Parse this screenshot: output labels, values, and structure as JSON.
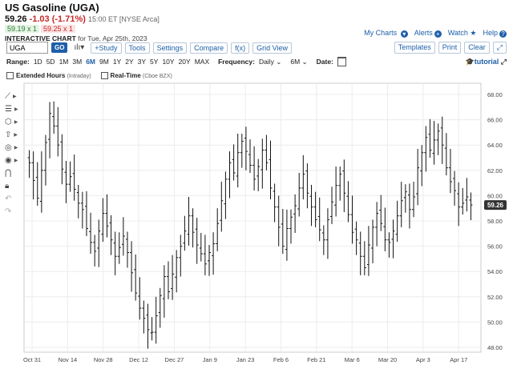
{
  "header": {
    "title": "US Gasoline (UGA)",
    "last": "59.26",
    "change": "-1.03 (-1.71%)",
    "time": "15:00 ET [NYSE Arca]",
    "bid": "59.19 x 1",
    "ask": "59.25 x 1",
    "chart_title": "INTERACTIVE CHART",
    "chart_date": "for Tue, Apr 25th, 2023"
  },
  "links": {
    "my_charts": "My Charts",
    "alerts": "Alerts",
    "watch": "Watch",
    "help": "Help"
  },
  "toolbar": {
    "symbol": "UGA",
    "go": "GO",
    "study": "+Study",
    "tools": "Tools",
    "settings": "Settings",
    "compare": "Compare",
    "fx": "f(x)",
    "grid_view": "Grid View",
    "templates": "Templates",
    "print": "Print",
    "clear": "Clear"
  },
  "range": {
    "label": "Range:",
    "options": [
      "1D",
      "5D",
      "1M",
      "3M",
      "6M",
      "9M",
      "1Y",
      "2Y",
      "3Y",
      "5Y",
      "10Y",
      "20Y",
      "MAX"
    ],
    "selected": "6M",
    "frequency_label": "Frequency:",
    "frequency": "Daily",
    "period": "6M",
    "date_label": "Date:",
    "tutorial": "tutorial"
  },
  "options_row": {
    "extended": "Extended Hours",
    "extended_note": "(Intraday)",
    "realtime": "Real-Time",
    "realtime_note": "(Cboe BZX)"
  },
  "chart_data": {
    "type": "ohlc",
    "x_labels": [
      "Oct 31",
      "Nov 14",
      "Nov 28",
      "Dec 12",
      "Dec 27",
      "Jan 9",
      "Jan 23",
      "Feb 6",
      "Feb 21",
      "Mar 6",
      "Mar 20",
      "Apr 3",
      "Apr 17"
    ],
    "y_ticks": [
      "48.00",
      "50.00",
      "52.00",
      "54.00",
      "56.00",
      "58.00",
      "60.00",
      "62.00",
      "64.00",
      "66.00",
      "68.00"
    ],
    "ylim": [
      48,
      68
    ],
    "last_label": "59.26",
    "closes": [
      62.6,
      61.2,
      59.8,
      62.0,
      64.2,
      66.5,
      65.5,
      64.0,
      62.1,
      60.9,
      61.5,
      60.5,
      59.4,
      58.9,
      57.4,
      56.3,
      55.6,
      57.2,
      58.6,
      57.6,
      56.5,
      55.2,
      55.9,
      56.8,
      55.5,
      53.9,
      52.3,
      51.1,
      50.3,
      49.4,
      49.2,
      50.5,
      52.1,
      53.6,
      52.4,
      53.8,
      55.1,
      56.0,
      57.2,
      58.4,
      57.1,
      56.1,
      55.4,
      54.6,
      55.5,
      56.2,
      57.8,
      59.6,
      61.3,
      62.6,
      61.8,
      63.4,
      64.3,
      63.5,
      62.4,
      61.3,
      62.3,
      63.6,
      62.6,
      60.6,
      59.1,
      57.5,
      56.0,
      57.4,
      58.3,
      59.2,
      60.6,
      61.7,
      60.2,
      59.1,
      58.1,
      57.3,
      56.5,
      58.1,
      59.5,
      60.8,
      61.7,
      60.2,
      58.5,
      57.1,
      56.5,
      55.2,
      54.3,
      56.1,
      57.5,
      58.6,
      57.8,
      56.5,
      56.3,
      57.2,
      58.4,
      59.6,
      60.3,
      58.9,
      59.9,
      62.2,
      63.4,
      64.6,
      63.6,
      64.4,
      65.1,
      64.0,
      62.2,
      61.1,
      60.4,
      59.1,
      59.4,
      59.9,
      59.26
    ]
  }
}
